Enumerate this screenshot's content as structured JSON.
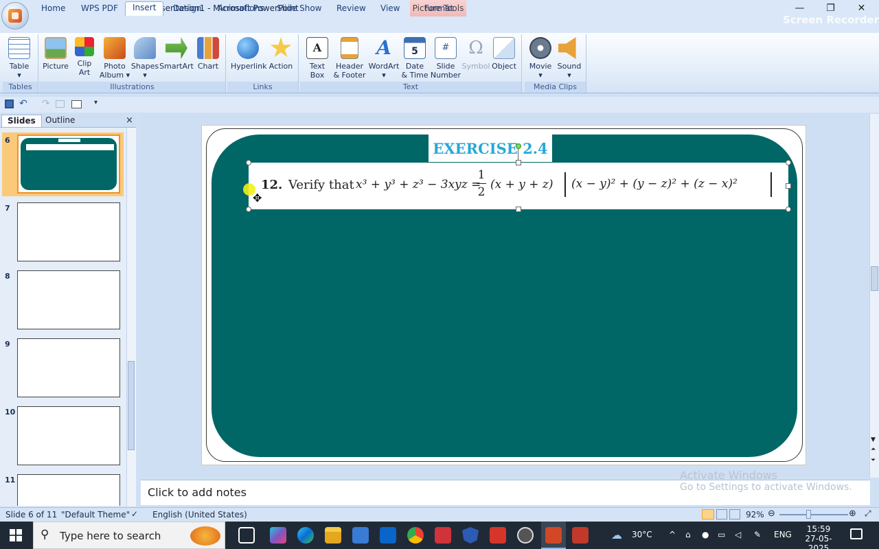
{
  "window": {
    "title": "Presentation1 - Microsoft PowerPoint",
    "contextual_tab_group": "Picture Tools",
    "controls": {
      "minimize": "—",
      "restore": "❐",
      "close": "✕"
    },
    "recorder_watermark": "Screen Recorder"
  },
  "ribbon_tabs": [
    {
      "label": "Home"
    },
    {
      "label": "WPS PDF"
    },
    {
      "label": "Insert",
      "active": true
    },
    {
      "label": "Design"
    },
    {
      "label": "Animations"
    },
    {
      "label": "Slide Show"
    },
    {
      "label": "Review"
    },
    {
      "label": "View"
    },
    {
      "label": "Format"
    }
  ],
  "ribbon": {
    "groups": [
      "Tables",
      "Illustrations",
      "Links",
      "Text",
      "Media Clips"
    ],
    "buttons": {
      "table": [
        "Table",
        "▾"
      ],
      "picture": [
        "Picture",
        ""
      ],
      "clipart": [
        "Clip",
        "Art"
      ],
      "photo_album": [
        "Photo",
        "Album ▾"
      ],
      "shapes": [
        "Shapes",
        "▾"
      ],
      "smartart": [
        "SmartArt",
        ""
      ],
      "chart": [
        "Chart",
        ""
      ],
      "hyperlink": [
        "Hyperlink",
        ""
      ],
      "action": [
        "Action",
        ""
      ],
      "text_box": [
        "Text",
        "Box"
      ],
      "header_footer": [
        "Header",
        "& Footer"
      ],
      "wordart": [
        "WordArt",
        "▾"
      ],
      "date_time": [
        "Date",
        "& Time"
      ],
      "slide_number": [
        "Slide",
        "Number"
      ],
      "symbol": [
        "Symbol",
        ""
      ],
      "object": [
        "Object",
        ""
      ],
      "movie": [
        "Movie",
        "▾"
      ],
      "sound": [
        "Sound",
        "▾"
      ]
    }
  },
  "left_pane": {
    "tabs": [
      "Slides",
      "Outline"
    ],
    "close": "×",
    "slide_numbers": [
      "6",
      "7",
      "8",
      "9",
      "10",
      "11"
    ]
  },
  "slide": {
    "heading": "EXERCISE 2.4",
    "question_number": "12.",
    "question_text": "Verify that",
    "equation_lhs": "x³ + y³ + z³ − 3xyz =",
    "fraction_num": "1",
    "fraction_den": "2",
    "equation_rhs": "(x + y + z)",
    "bracket_content": "(x − y)² + (y − z)² + (z − x)²",
    "colors": {
      "panel": "#006766",
      "heading": "#28a8d8"
    }
  },
  "notes": {
    "placeholder": "Click to add notes"
  },
  "activation": {
    "line1": "Activate Windows",
    "line2": "Go to Settings to activate Windows."
  },
  "status": {
    "slide_info": "Slide 6 of 11",
    "theme": "\"Default Theme\"",
    "language": "English (United States)",
    "zoom": "92%"
  },
  "taskbar": {
    "search_placeholder": "Type here to search",
    "temperature": "30°C",
    "lang": "ENG",
    "time": "15:59",
    "date": "27-05-2025"
  }
}
